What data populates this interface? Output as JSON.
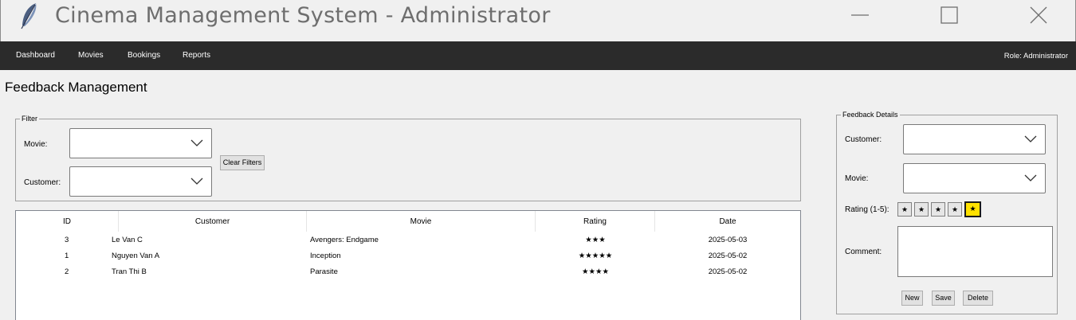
{
  "window": {
    "title": "Cinema Management System - Administrator",
    "icon": "feather-icon",
    "controls": [
      "minimize-icon",
      "maximize-icon",
      "close-icon"
    ]
  },
  "menu": {
    "items": [
      "Dashboard",
      "Movies",
      "Bookings",
      "Reports"
    ],
    "role": "Role: Administrator"
  },
  "page": {
    "title": "Feedback Management"
  },
  "filter": {
    "legend": "Filter",
    "movie_label": "Movie:",
    "movie_value": "",
    "customer_label": "Customer:",
    "customer_value": "",
    "clear_button": "Clear Filters"
  },
  "table": {
    "columns": [
      "ID",
      "Customer",
      "Movie",
      "Rating",
      "Date"
    ],
    "rows": [
      {
        "id": "3",
        "customer": "Le Van C",
        "movie": "Avengers: Endgame",
        "rating": "★★★",
        "date": "2025-05-03"
      },
      {
        "id": "1",
        "customer": "Nguyen Van A",
        "movie": "Inception",
        "rating": "★★★★★",
        "date": "2025-05-02"
      },
      {
        "id": "2",
        "customer": "Tran Thi B",
        "movie": "Parasite",
        "rating": "★★★★",
        "date": "2025-05-02"
      }
    ]
  },
  "details": {
    "legend": "Feedback Details",
    "customer_label": "Customer:",
    "customer_value": "",
    "movie_label": "Movie:",
    "movie_value": "",
    "rating_label": "Rating (1-5):",
    "rating_stars": [
      "★",
      "★",
      "★",
      "★",
      "★"
    ],
    "rating_selected": 5,
    "comment_label": "Comment:",
    "comment_value": "",
    "buttons": {
      "new": "New",
      "save": "Save",
      "delete": "Delete"
    }
  },
  "colors": {
    "menubar_bg": "#2b2b2b",
    "selected_star_bg": "#ffe100",
    "window_bg": "#f0f0f0"
  }
}
